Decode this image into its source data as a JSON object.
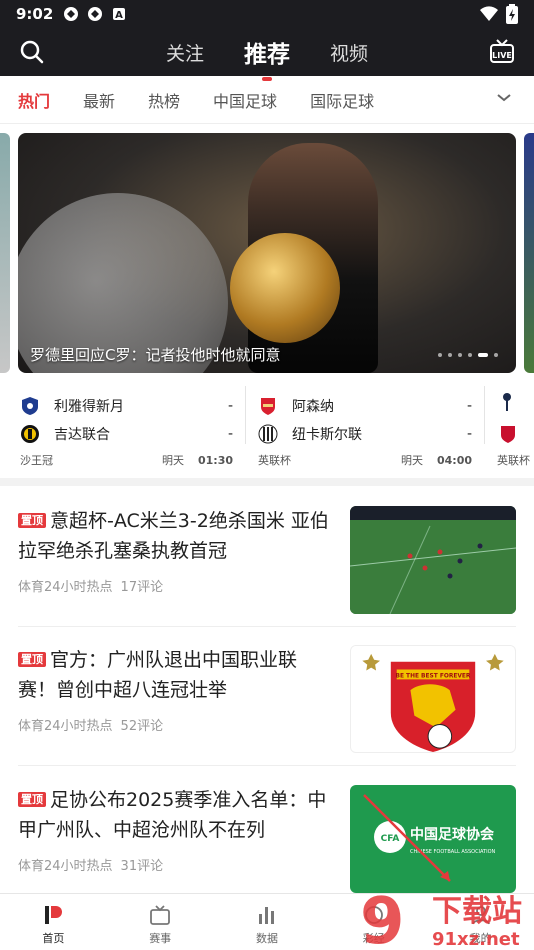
{
  "status": {
    "time": "9:02",
    "icons": [
      "vpn-icon",
      "vpn-icon",
      "a-icon"
    ],
    "right_icons": [
      "wifi-icon",
      "battery-icon"
    ]
  },
  "topnav": {
    "tabs": [
      "关注",
      "推荐",
      "视频"
    ],
    "active_tab": "推荐",
    "icons": {
      "left": "search-icon",
      "right": "live-tv-icon"
    }
  },
  "subtabs": {
    "items": [
      "热门",
      "最新",
      "热榜",
      "中国足球",
      "国际足球"
    ],
    "active": "热门"
  },
  "banner": {
    "caption": "罗德里回应C罗：记者投他时他就同意",
    "dot_count": 6,
    "active_dot": 5
  },
  "matches": [
    {
      "home": "利雅得新月",
      "home_score": "-",
      "away": "吉达联合",
      "away_score": "-",
      "league": "沙王冠",
      "day": "明天",
      "time": "01:30",
      "home_color": "#1f3c8f",
      "away_color": "#f2c200"
    },
    {
      "home": "阿森纳",
      "home_score": "-",
      "away": "纽卡斯尔联",
      "away_score": "-",
      "league": "英联杯",
      "day": "明天",
      "time": "04:00",
      "home_color": "#d9202f",
      "away_color": "#222222"
    },
    {
      "home_color": "#1b2a4a",
      "away_color": "#c8102e",
      "league": "英联杯"
    }
  ],
  "news": [
    {
      "badge": "置顶",
      "title": "意超杯-AC米兰3-2绝杀国米 亚伯拉罕绝杀孔塞桑执教首冠",
      "source": "体育24小时热点",
      "comments": "17评论",
      "thumb": "soccer-field"
    },
    {
      "badge": "置顶",
      "title": "官方：广州队退出中国职业联赛！曾创中超八连冠壮举",
      "source": "体育24小时热点",
      "comments": "52评论",
      "thumb": "guangzhou-crest"
    },
    {
      "badge": "置顶",
      "title": "足协公布2025赛季准入名单：中甲广州队、中超沧州队不在列",
      "source": "体育24小时热点",
      "comments": "31评论",
      "thumb": "cfa-logo"
    }
  ],
  "thumb_text": {
    "crest_banner": "BE THE BEST FOREVER",
    "cfa_cn": "中国足球协会",
    "cfa_en": "CHINESE FOOTBALL ASSOCIATION",
    "cfa_abbr": "CFA"
  },
  "bottom_nav": [
    {
      "label": "首页",
      "icon": "home-icon",
      "active": true
    },
    {
      "label": "赛事",
      "icon": "tv-icon",
      "active": false
    },
    {
      "label": "数据",
      "icon": "bar-chart-icon",
      "active": false
    },
    {
      "label": "彩经",
      "icon": "lottery-icon",
      "active": false
    },
    {
      "label": "我的",
      "icon": "user-icon",
      "active": false
    }
  ],
  "watermark": {
    "text_cn": "下载站",
    "text_en": "91xz.net",
    "number": "9"
  },
  "colors": {
    "accent": "#e4393c",
    "topbar": "#1c1c20"
  }
}
